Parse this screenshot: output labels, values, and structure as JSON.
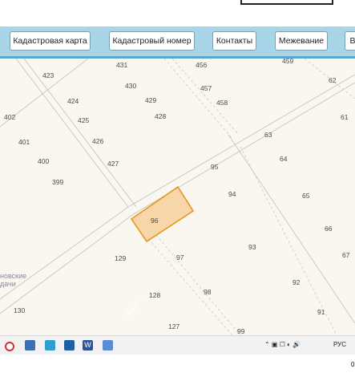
{
  "nav": {
    "cadastral_map": "Кадастровая карта",
    "cadastral_number": "Кадастровый номер",
    "contacts": "Контакты",
    "surveying": "Межевание",
    "cut_button": "В"
  },
  "map": {
    "highlighted_plot": "96",
    "area_name": "…новские\n…дачи",
    "plots": [
      "431",
      "456",
      "459",
      "423",
      "430",
      "457",
      "62",
      "424",
      "429",
      "458",
      "402",
      "425",
      "428",
      "61",
      "401",
      "426",
      "63",
      "400",
      "427",
      "95",
      "64",
      "399",
      "94",
      "65",
      "66",
      "129",
      "97",
      "93",
      "67",
      "128",
      "98",
      "92",
      "130",
      "127",
      "91",
      "99",
      "96"
    ]
  },
  "taskbar": {
    "tray_lang": "РУС",
    "tray_time": "0"
  },
  "colors": {
    "navbar": "#a9d5e8",
    "highlight_fill": "#f5c88a",
    "highlight_stroke": "#e8961e"
  }
}
